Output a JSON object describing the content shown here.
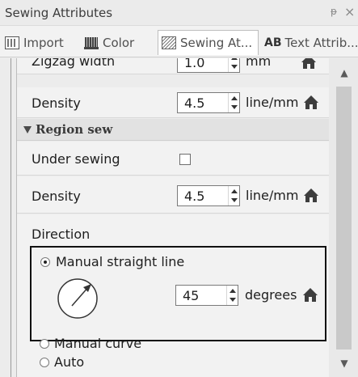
{
  "window": {
    "title": "Sewing Attributes",
    "pin_icon": "ᵽ",
    "close_icon": "×"
  },
  "tabs": [
    {
      "label": "Import",
      "icon": "import-icon"
    },
    {
      "label": "Color",
      "icon": "color-icon"
    },
    {
      "label": "Sewing At...",
      "icon": "sewing-icon",
      "active": true
    },
    {
      "label": "Text Attrib...",
      "icon_text": "AB"
    }
  ],
  "rows": {
    "zigzag": {
      "label": "Zigzag width",
      "value": "1.0",
      "unit": "mm"
    },
    "density1": {
      "label": "Density",
      "value": "4.5",
      "unit": "line/mm"
    },
    "region_title": "Region sew",
    "under_sewing": {
      "label": "Under sewing",
      "checked": false
    },
    "density2": {
      "label": "Density",
      "value": "4.5",
      "unit": "line/mm"
    },
    "direction": {
      "label": "Direction",
      "options": [
        {
          "label": "Manual straight line",
          "checked": true
        },
        {
          "label": "Manual curve",
          "checked": false
        },
        {
          "label": "Auto",
          "checked": false
        }
      ],
      "angle_value": "45",
      "angle_unit": "degrees"
    }
  },
  "colors": {
    "panel_bg": "#ececec",
    "row_bg": "#f2f2f2",
    "section_bg": "#e2e2e2",
    "highlight_border": "#111111"
  }
}
